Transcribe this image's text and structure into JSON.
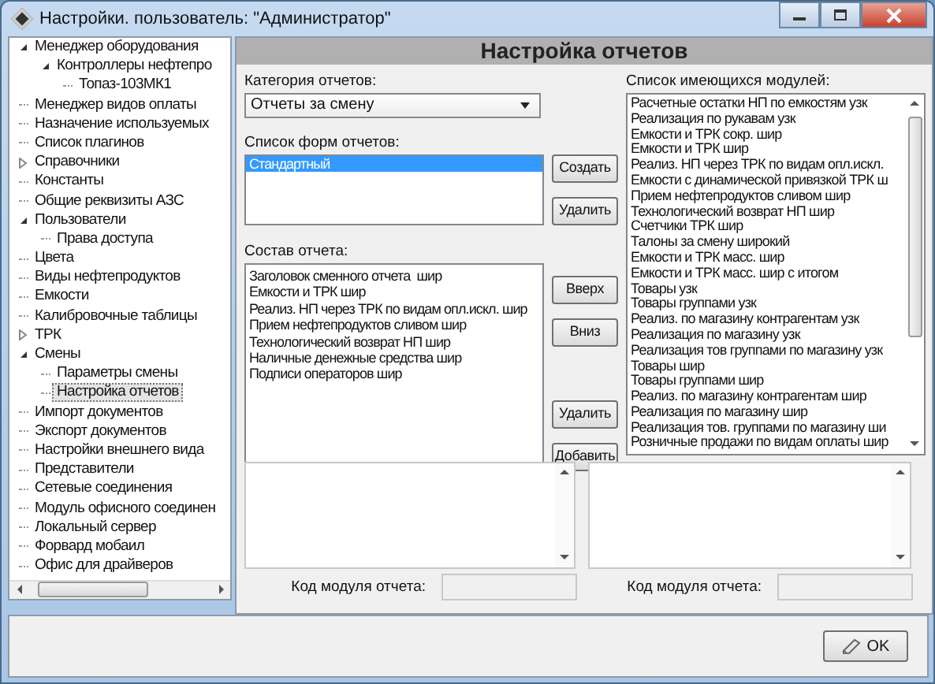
{
  "window": {
    "title": "Настройки. пользователь: \"Администратор\""
  },
  "tree": [
    {
      "text": "Менеджер оборудования",
      "selected": false,
      "expanded": true,
      "children": [
        {
          "text": "Контроллеры нефтепро",
          "selected": false,
          "expanded": true,
          "children": [
            {
              "text": "Топаз-103МК1",
              "selected": false
            }
          ]
        }
      ]
    },
    {
      "text": "Менеджер видов оплаты",
      "selected": false
    },
    {
      "text": "Назначение используемых",
      "selected": false
    },
    {
      "text": "Список плагинов",
      "selected": false
    },
    {
      "text": "Справочники",
      "selected": false,
      "expanded": false
    },
    {
      "text": "Константы",
      "selected": false
    },
    {
      "text": "Общие реквизиты АЗС",
      "selected": false
    },
    {
      "text": "Пользователи",
      "selected": false,
      "expanded": true,
      "children": [
        {
          "text": "Права доступа",
          "selected": false
        }
      ]
    },
    {
      "text": "Цвета",
      "selected": false
    },
    {
      "text": "Виды нефтепродуктов",
      "selected": false
    },
    {
      "text": "Емкости",
      "selected": false
    },
    {
      "text": "Калибровочные таблицы",
      "selected": false
    },
    {
      "text": "ТРК",
      "selected": false,
      "expanded": false
    },
    {
      "text": "Смены",
      "selected": false,
      "expanded": true,
      "children": [
        {
          "text": "Параметры смены",
          "selected": false
        },
        {
          "text": "Настройка отчетов",
          "selected": true
        }
      ]
    },
    {
      "text": "Импорт документов",
      "selected": false
    },
    {
      "text": "Экспорт документов",
      "selected": false
    },
    {
      "text": "Настройки внешнего вида",
      "selected": false
    },
    {
      "text": "Представители",
      "selected": false
    },
    {
      "text": "Сетевые соединения",
      "selected": false
    },
    {
      "text": "Модуль офисного соединен",
      "selected": false
    },
    {
      "text": "Локальный сервер",
      "selected": false
    },
    {
      "text": "Форвард мобаил",
      "selected": false
    },
    {
      "text": "Офис для драйверов",
      "selected": false
    }
  ],
  "panel": {
    "title": "Настройка отчетов",
    "category": {
      "label": "Категория отчетов:",
      "value": "Отчеты за смену"
    },
    "forms": {
      "label": "Список форм отчетов:",
      "items": [
        {
          "text": "Стандартный",
          "selected": true
        }
      ],
      "buttons": [
        "Создать",
        "Удалить"
      ]
    },
    "composition": {
      "label": "Состав отчета:",
      "items": [
        "Заголовок сменного отчета  шир",
        "Емкости и ТРК шир",
        "Реализ. НП через ТРК по видам опл.искл. шир",
        "Прием нефтепродуктов сливом шир",
        "Технологический возврат НП шир",
        "Наличные денежные средства шир",
        "Подписи операторов шир"
      ],
      "buttons_top": [
        "Вверх",
        "Вниз"
      ],
      "buttons_bottom": [
        "Удалить",
        "Добавить"
      ]
    },
    "modules": {
      "label": "Список имеющихся модулей:",
      "items": [
        "Расчетные остатки НП по емкостям узк",
        "Реализация по рукавам узк",
        "Емкости и ТРК сокр. шир",
        "Емкости и ТРК шир",
        "Реализ. НП через ТРК по видам опл.искл.",
        "Емкости с динамической привязкой ТРК ш",
        "Прием нефтепродуктов сливом шир",
        "Технологический возврат НП шир",
        "Счетчики ТРК шир",
        "Талоны за смену широкий",
        "Емкости и ТРК масс. шир",
        "Емкости и ТРК масс. шир с итогом",
        "Товары узк",
        "Товары группами узк",
        "Реализ. по магазину контрагентам узк",
        "Реализация по магазину узк",
        "Реализация тов группами по магазину узк",
        "Товары шир",
        "Товары группами шир",
        "Реализ. по магазину контрагентам шир",
        "Реализация по магазину шир",
        "Реализация тов. группами по магазину ши",
        "Розничные продажи по видам оплаты шир"
      ]
    },
    "code_fields": [
      {
        "label": "Код модуля отчета:"
      },
      {
        "label": "Код модуля отчета:"
      }
    ]
  },
  "buttons": [
    "OK"
  ]
}
